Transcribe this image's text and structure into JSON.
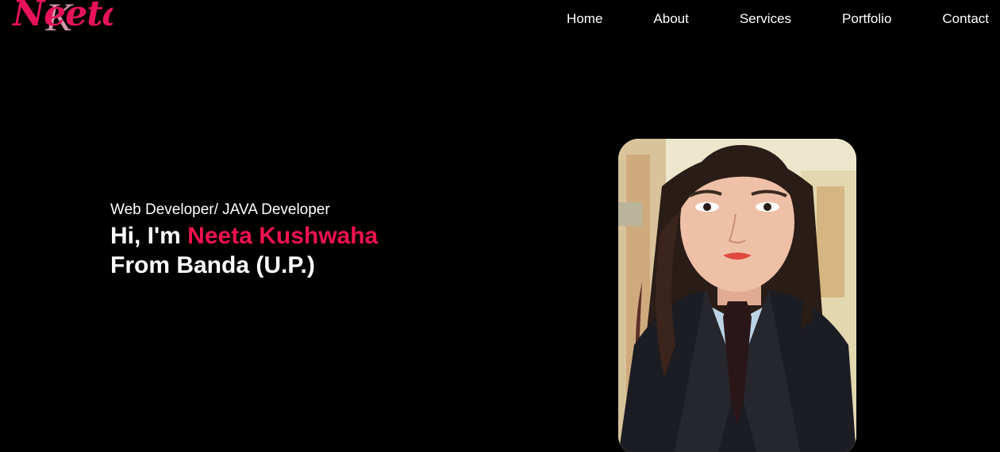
{
  "logo": {
    "text": "Neeta",
    "accent_letter": "K",
    "color": "#e8125a"
  },
  "nav": {
    "items": [
      {
        "label": "Home"
      },
      {
        "label": "About"
      },
      {
        "label": "Services"
      },
      {
        "label": "Portfolio"
      },
      {
        "label": "Contact"
      }
    ]
  },
  "hero": {
    "subtitle": "Web Developer/ JAVA Developer",
    "greeting": "Hi, I'm",
    "name": "Neeta Kushwaha",
    "location": "From Banda (U.P.)",
    "name_color": "#f0124f"
  },
  "photo": {
    "icon": "portrait-photo"
  },
  "colors": {
    "background": "#000000",
    "text": "#ffffff",
    "accent": "#f0124f"
  }
}
